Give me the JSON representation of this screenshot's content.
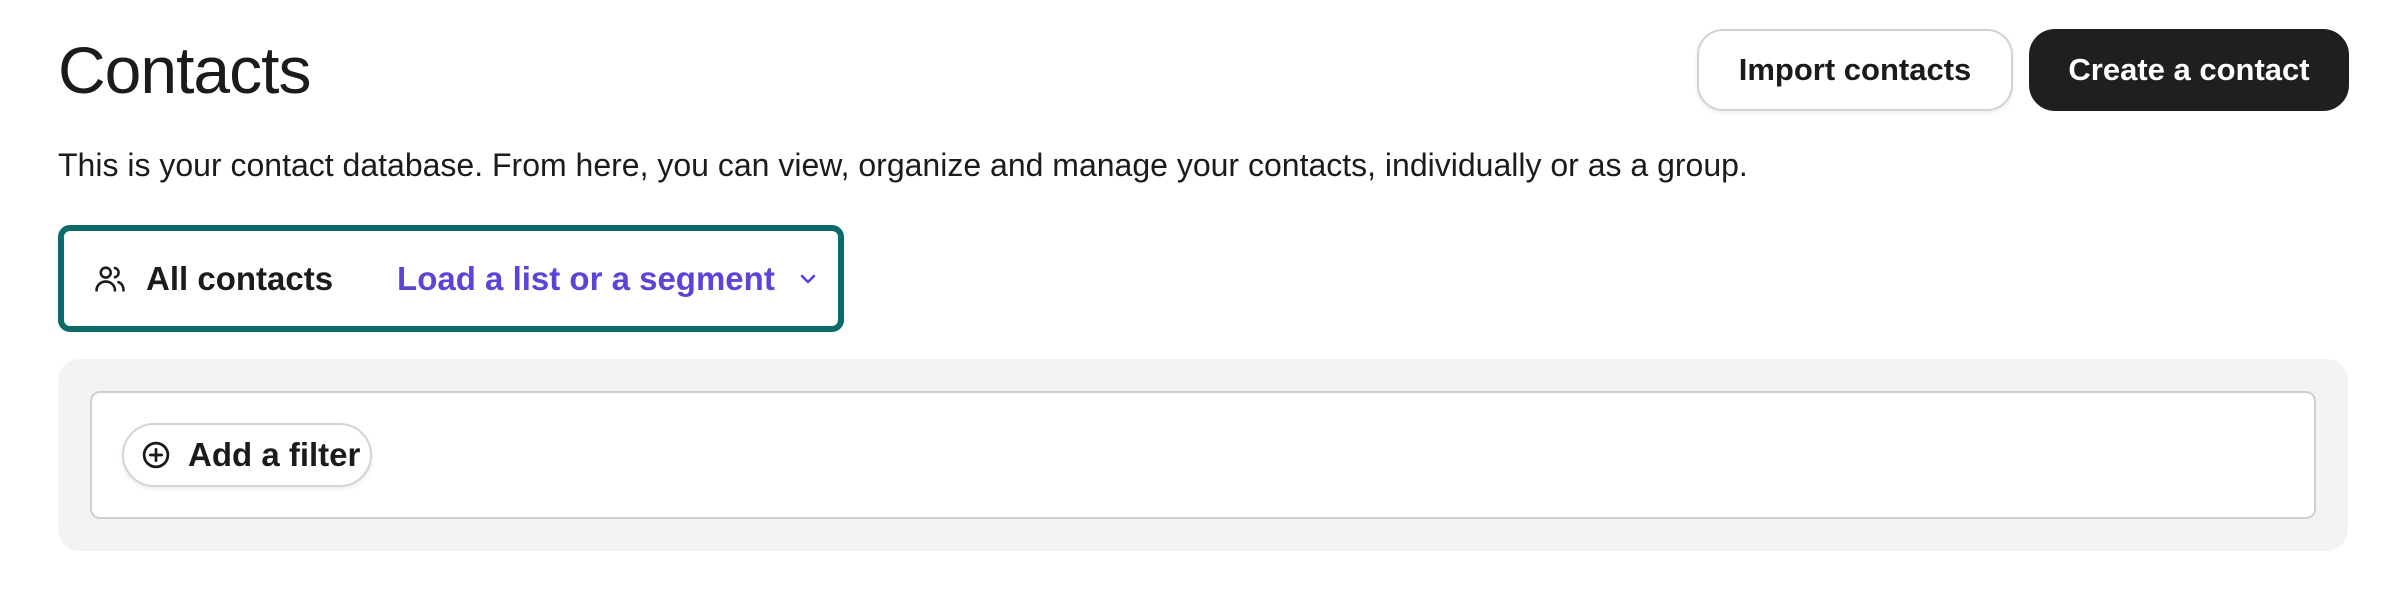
{
  "header": {
    "title": "Contacts",
    "import_label": "Import contacts",
    "create_label": "Create a contact"
  },
  "description": "This is your contact database. From here, you can view, organize and manage your contacts, individually or as a group.",
  "selector": {
    "icon": "users-icon",
    "all_contacts_label": "All contacts",
    "load_label": "Load a list or a segment",
    "dropdown_icon": "chevron-down-icon"
  },
  "filters": {
    "icon": "plus-circle-icon",
    "add_filter_label": "Add a filter"
  },
  "colors": {
    "accent_border": "#0b6a6a",
    "link": "#5b45d8",
    "primary_button": "#1f1f1f",
    "panel_background": "#f3f3f3"
  }
}
